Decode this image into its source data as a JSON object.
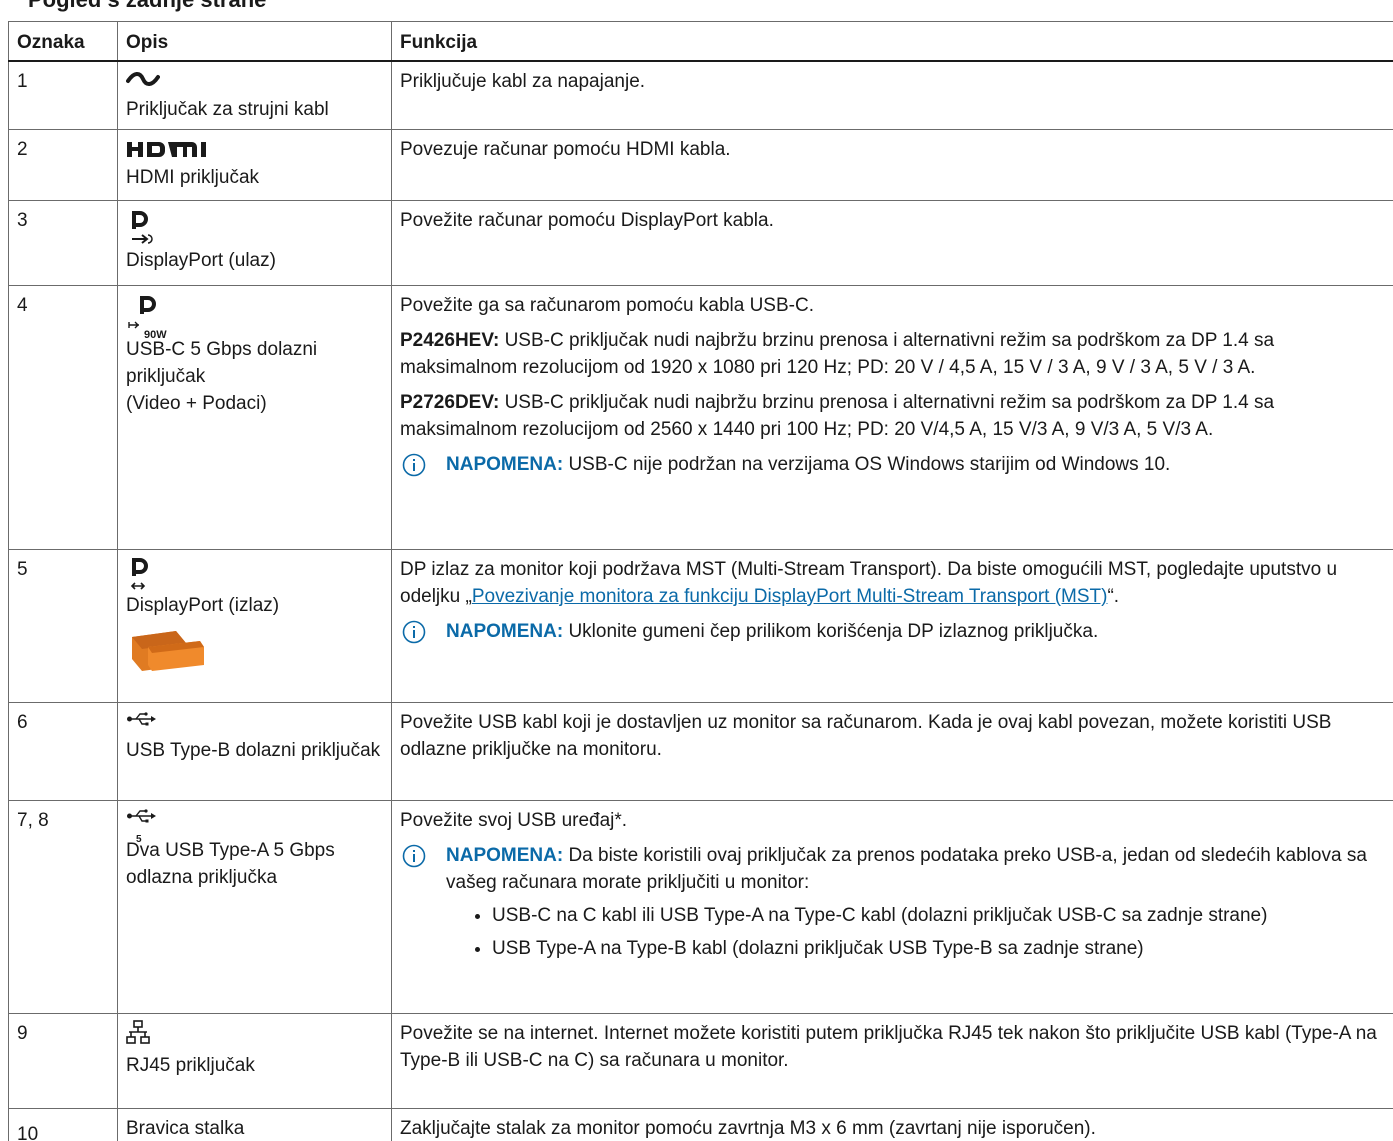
{
  "heading": "Pogled s zadnje strane",
  "table": {
    "headers": [
      "Oznaka",
      "Opis",
      "Funkcija"
    ],
    "rows": [
      {
        "num": "1",
        "icon": "power-wave-icon",
        "desc": [
          "Priključak za strujni kabl"
        ],
        "func": "Priključuje kabl za napajanje."
      },
      {
        "num": "2",
        "icon": "hdmi-icon",
        "desc": [
          "HDMI priključak"
        ],
        "func": "Povezuje računar pomoću HDMI kabla."
      },
      {
        "num": "3",
        "icon": "displayport-in-icon",
        "desc": [
          "DisplayPort (ulaz)"
        ],
        "func": "Povežite računar pomoću DisplayPort kabla."
      },
      {
        "num": "4",
        "icon": "displayport-usbc-90w-icon",
        "icon_caption": "90W",
        "desc": [
          "USB-C 5 Gbps dolazni priključak",
          "(Video + Podaci)"
        ],
        "func": "Povežite ga sa računarom pomoću kabla USB-C.",
        "model1": "P2426HEV:",
        "model1_text": "USB-C priključak nudi najbržu brzinu prenosa i alternativni režim sa podrškom za DP 1.4 sa maksimalnom rezolucijom od 1920 x 1080 pri 120 Hz; PD: 20 V / 4,5 A, 15 V / 3 A, 9 V / 3 A, 5 V / 3 A.",
        "model2": "P2726DEV:",
        "model2_text": "USB-C priključak nudi najbržu brzinu prenosa i alternativni režim sa podrškom za DP 1.4 sa maksimalnom rezolucijom od 2560 x 1440 pri 100 Hz; PD: 20 V/4,5 A, 15 V/3 A, 9 V/3 A, 5 V/3 A.",
        "note_label": "NAPOMENA:",
        "note_text": "USB-C nije podržan na verzijama OS Windows starijim od Windows 10."
      },
      {
        "num": "5",
        "icon": "displayport-out-icon",
        "desc": [
          "DisplayPort (izlaz)"
        ],
        "func_pre": "DP izlaz za monitor koji podržava MST (Multi-Stream Transport). Da biste omogućili MST, pogledajte uputstvo u odeljku „",
        "func_link": "Povezivanje monitora za funkciju DisplayPort Multi-Stream Transport (MST)",
        "func_post": "“.",
        "note_label": "NAPOMENA:",
        "note_text": "Uklonite gumeni čep prilikom korišćenja DP izlaznog priključka."
      },
      {
        "num": "6",
        "icon": "usb-icon",
        "desc": [
          "USB Type-B dolazni priključak"
        ],
        "func": "Povežite USB kabl koji je dostavljen uz monitor sa računarom. Kada je ovaj kabl povezan, možete koristiti USB odlazne priključke na monitoru."
      },
      {
        "num": "7, 8",
        "icon": "usb-5gbps-icon",
        "icon_caption": "5",
        "desc": [
          "Dva USB Type-A 5 Gbps odlazna priključka"
        ],
        "func": "Povežite svoj USB uređaj*.",
        "note_label": "NAPOMENA:",
        "note_text": "Da biste koristili ovaj priključak za prenos podataka preko USB-a, jedan od sledećih kablova sa vašeg računara morate priključiti u monitor:",
        "bullets": [
          "USB-C na C kabl ili USB Type-A na Type-C kabl (dolazni priključak USB-C sa zadnje strane)",
          "USB Type-A na Type-B kabl (dolazni priključak USB Type-B sa zadnje strane)"
        ]
      },
      {
        "num": "9",
        "icon": "network-icon",
        "desc": [
          "RJ45 priključak"
        ],
        "func": "Povežite se na internet. Internet možete koristiti putem priključka RJ45 tek nakon što priključite USB kabl (Type-A na Type-B ili USB-C na C) sa računara u monitor."
      },
      {
        "num": "10",
        "desc": [
          "Bravica stalka"
        ],
        "func": "Zaključajte stalak za monitor pomoću zavrtnja M3 x 6 mm (zavrtanj nije isporučen)."
      }
    ]
  },
  "colors": {
    "note_blue": "#0b6aa8",
    "plug_orange": "#e07b22",
    "border": "#6b6b6b"
  }
}
